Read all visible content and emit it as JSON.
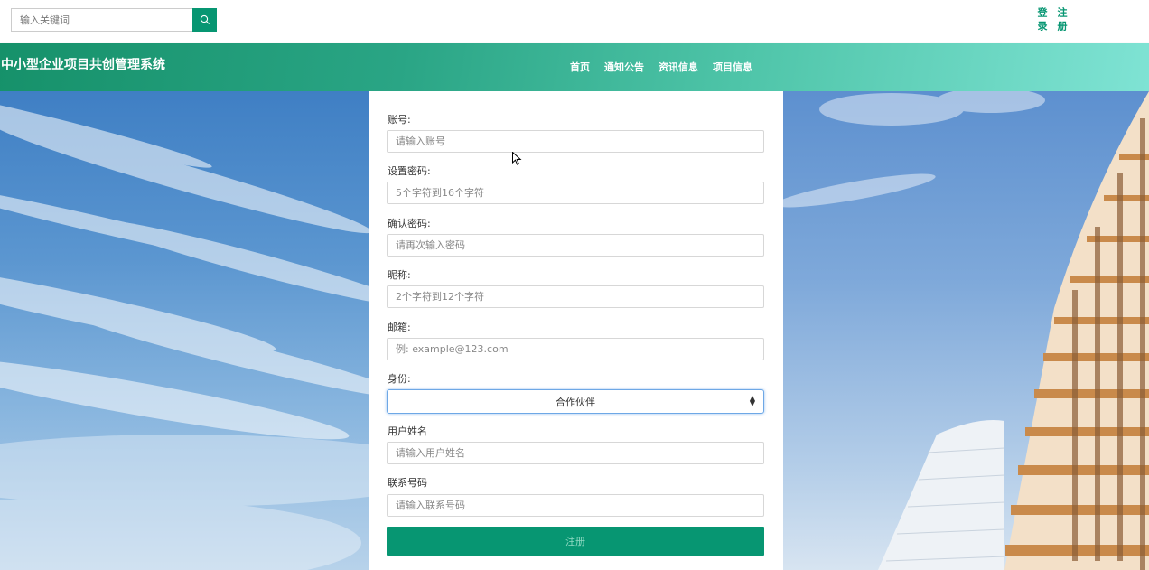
{
  "header": {
    "search": {
      "placeholder": "输入关键词",
      "value": ""
    },
    "auth": {
      "login": "登录",
      "register": "注册"
    }
  },
  "nav": {
    "site_title": "中小型企业项目共创管理系统",
    "menu": [
      "首页",
      "通知公告",
      "资讯信息",
      "项目信息"
    ]
  },
  "form": {
    "account": {
      "label": "账号:",
      "placeholder": "请输入账号"
    },
    "password": {
      "label": "设置密码:",
      "placeholder": "5个字符到16个字符"
    },
    "confirm": {
      "label": "确认密码:",
      "placeholder": "请再次输入密码"
    },
    "nickname": {
      "label": "昵称:",
      "placeholder": "2个字符到12个字符"
    },
    "email": {
      "label": "邮箱:",
      "placeholder": "例: example@123.com"
    },
    "role": {
      "label": "身份:",
      "value": "合作伙伴"
    },
    "username": {
      "label": "用户姓名",
      "placeholder": "请输入用户姓名"
    },
    "phone": {
      "label": "联系号码",
      "placeholder": "请输入联系号码"
    },
    "submit_label": "注册"
  },
  "colors": {
    "accent": "#079672",
    "nav_start": "#16916a",
    "nav_end": "#7fe3d4"
  }
}
